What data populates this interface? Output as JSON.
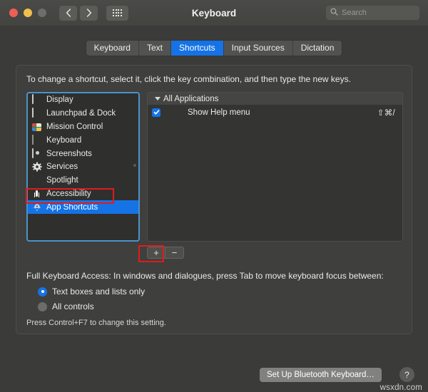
{
  "window": {
    "title": "Keyboard",
    "traffic_lights": [
      "close-red",
      "minimize-yellow",
      "zoom-disabled"
    ],
    "back_icon": "chevron-left-icon",
    "forward_icon": "chevron-right-icon",
    "grid_icon": "show-all-grid-icon"
  },
  "search": {
    "placeholder": "Search",
    "icon": "search-icon"
  },
  "tabs": [
    {
      "label": "Keyboard",
      "active": false
    },
    {
      "label": "Text",
      "active": false
    },
    {
      "label": "Shortcuts",
      "active": true
    },
    {
      "label": "Input Sources",
      "active": false
    },
    {
      "label": "Dictation",
      "active": false
    }
  ],
  "panel": {
    "instruction": "To change a shortcut, select it, click the key combination, and then type the new keys."
  },
  "categories": [
    {
      "label": "Display",
      "icon": "display-icon",
      "selected": false
    },
    {
      "label": "Launchpad & Dock",
      "icon": "launchpad-dock-icon",
      "selected": false
    },
    {
      "label": "Mission Control",
      "icon": "mission-control-icon",
      "selected": false
    },
    {
      "label": "Keyboard",
      "icon": "keyboard-icon",
      "selected": false
    },
    {
      "label": "Screenshots",
      "icon": "screenshots-icon",
      "selected": false
    },
    {
      "label": "Services",
      "icon": "services-gear-icon",
      "selected": false
    },
    {
      "label": "Spotlight",
      "icon": "spotlight-document-icon",
      "selected": false
    },
    {
      "label": "Accessibility",
      "icon": "accessibility-icon",
      "selected": false
    },
    {
      "label": "App Shortcuts",
      "icon": "app-shortcuts-icon",
      "selected": true
    }
  ],
  "shortcuts": {
    "group_label": "All Applications",
    "disclosure": "disclosure-triangle-open-icon",
    "rows": [
      {
        "name": "Show Help menu",
        "key": "⇧⌘/",
        "checked": true
      }
    ]
  },
  "list_buttons": {
    "add_label": "+",
    "remove_label": "−"
  },
  "full_keyboard_access": {
    "label": "Full Keyboard Access: In windows and dialogues, press Tab to move keyboard focus between:",
    "options": [
      {
        "label": "Text boxes and lists only",
        "selected": true
      },
      {
        "label": "All controls",
        "selected": false
      }
    ],
    "hint": "Press Control+F7 to change this setting."
  },
  "footer": {
    "bluetooth_button": "Set Up Bluetooth Keyboard…",
    "help_button": "?",
    "watermark": "wsxdn.com"
  },
  "colors": {
    "accent_blue": "#1573e6",
    "window_bg": "#3b3b39",
    "panel_bg": "#3f3f3d",
    "annotation_red": "#e01b1b",
    "focus_ring": "#4a93c9"
  }
}
